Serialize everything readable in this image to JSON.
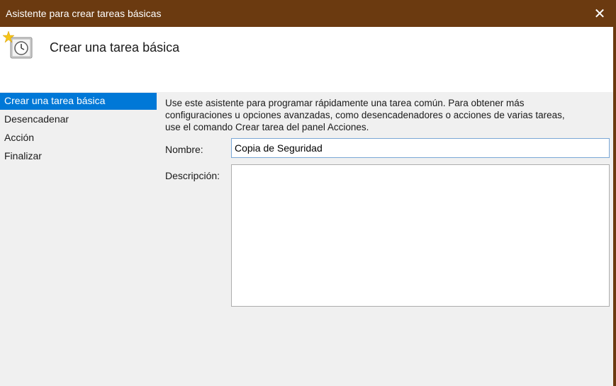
{
  "window": {
    "title": "Asistente para crear tareas básicas",
    "close_glyph": "✕"
  },
  "header": {
    "icon": "scheduled-task-clock-icon",
    "heading": "Crear una tarea básica"
  },
  "sidebar": {
    "items": [
      {
        "label": "Crear una tarea básica",
        "active": true
      },
      {
        "label": "Desencadenar",
        "active": false
      },
      {
        "label": "Acción",
        "active": false
      },
      {
        "label": "Finalizar",
        "active": false
      }
    ]
  },
  "main": {
    "intro_line1": "Use este asistente para programar rápidamente una tarea común. Para obtener más",
    "intro_line2": "configuraciones u opciones avanzadas, como desencadenadores o acciones de varias tareas,",
    "intro_line3": "use el comando Crear tarea del panel Acciones.",
    "name_label": "Nombre:",
    "name_value": "Copia de Seguridad",
    "description_label": "Descripción:",
    "description_value": ""
  },
  "colors": {
    "titlebar": "#6b3a10",
    "selection": "#0078d7"
  }
}
